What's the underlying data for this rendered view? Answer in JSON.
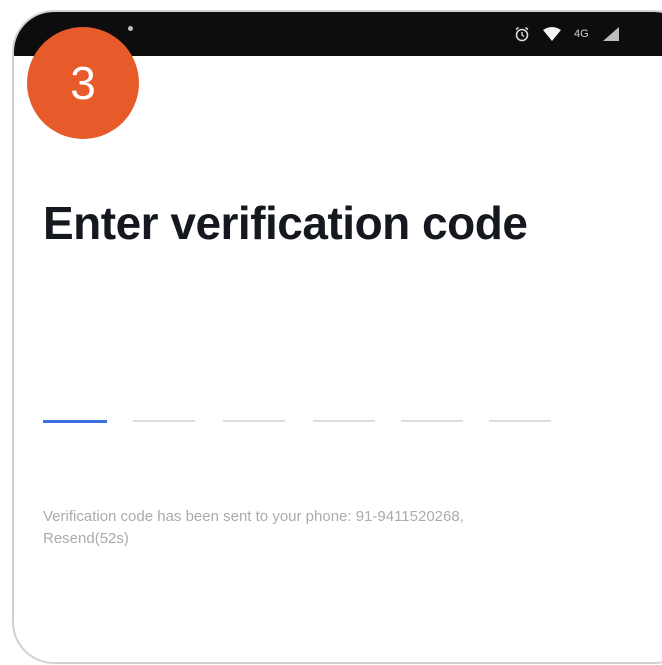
{
  "status_bar": {
    "network": "4G"
  },
  "step": {
    "number": "3",
    "color": "#e75a2a"
  },
  "screen": {
    "title": "Enter verification code",
    "code_length": 6,
    "active_slot": 0,
    "accent_color": "#3a72e0",
    "hint_text": "Verification code has been sent to your phone: 91-9411520268,",
    "resend_label": "Resend(52s)"
  },
  "icons": [
    "back-arrow-icon",
    "alarm-icon",
    "wifi-icon",
    "signal-icon"
  ]
}
